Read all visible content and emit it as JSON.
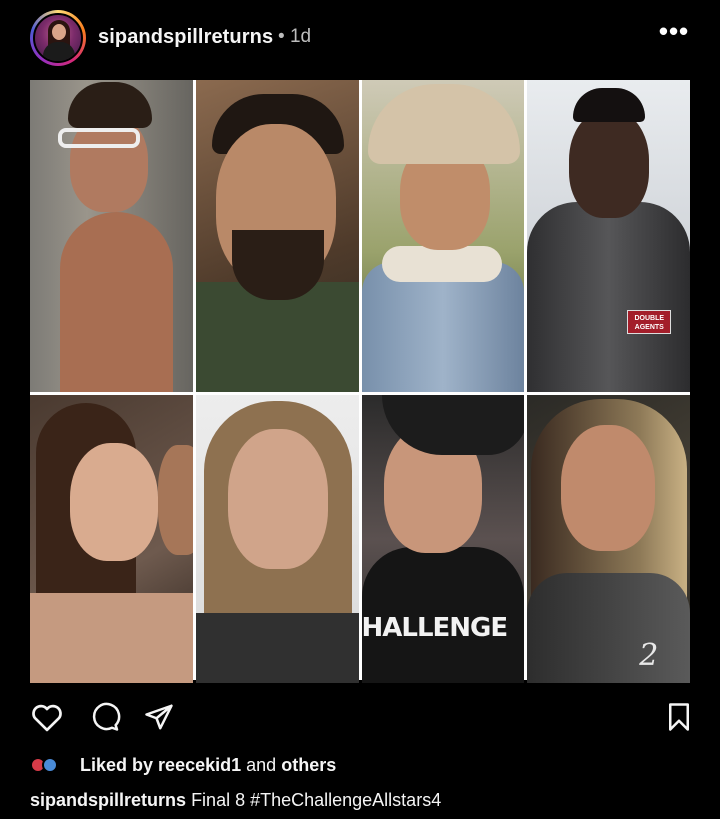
{
  "post": {
    "username": "sipandspillreturns",
    "separator": "•",
    "time_ago": "1d"
  },
  "media": {
    "cells": [
      {
        "label": "contestant-1"
      },
      {
        "label": "contestant-2"
      },
      {
        "label": "contestant-3"
      },
      {
        "label": "contestant-4"
      },
      {
        "label": "contestant-5"
      },
      {
        "label": "contestant-6"
      },
      {
        "label": "contestant-7"
      },
      {
        "label": "contestant-8"
      }
    ],
    "shirt_print": "HALLENGE",
    "patch_text": "DOUBLE AGENTS",
    "scribble": "2"
  },
  "actions": {
    "icons": [
      "heart-icon",
      "comment-icon",
      "share-icon",
      "save-icon"
    ]
  },
  "likes": {
    "prefix": "Liked by",
    "user": "reecekid1",
    "middle": "and",
    "suffix": "others"
  },
  "caption": {
    "username": "sipandspillreturns",
    "text": "Final 8 #TheChallengeAllstars4"
  },
  "colors": {
    "background": "#000000",
    "text": "#f5f5f5",
    "muted": "#bdbdbd"
  }
}
